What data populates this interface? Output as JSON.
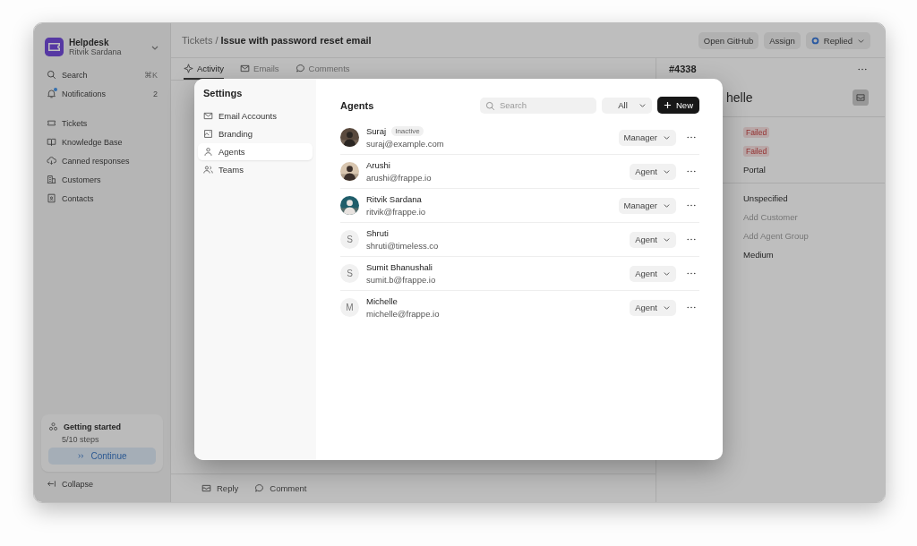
{
  "sidebar": {
    "app_name": "Helpdesk",
    "user_name": "Ritvik Sardana",
    "search": {
      "label": "Search",
      "shortcut": "⌘K"
    },
    "notifications": {
      "label": "Notifications",
      "count": "2",
      "unread": true
    },
    "items": [
      {
        "label": "Tickets"
      },
      {
        "label": "Knowledge Base"
      },
      {
        "label": "Canned responses"
      },
      {
        "label": "Customers"
      },
      {
        "label": "Contacts"
      }
    ],
    "getting_started": {
      "title": "Getting started",
      "steps": "5/10 steps",
      "button": "Continue"
    },
    "collapse": "Collapse"
  },
  "header": {
    "breadcrumb_parent": "Tickets",
    "separator": "/",
    "title": "Issue with password reset email",
    "buttons": [
      "Open GitHub",
      "Assign"
    ],
    "status": "Replied"
  },
  "tabs": [
    {
      "label": "Activity",
      "selected": true
    },
    {
      "label": "Emails",
      "selected": false
    },
    {
      "label": "Comments",
      "selected": false
    }
  ],
  "ticket_panel": {
    "id": "#4338",
    "contact_name": "helle",
    "fields": [
      {
        "value": "Failed",
        "kind": "error"
      },
      {
        "value": "Failed",
        "kind": "error"
      },
      {
        "value": "Portal",
        "kind": "value"
      },
      {
        "value": "Unspecified",
        "kind": "value"
      },
      {
        "placeholder": "Add Customer",
        "kind": "placeholder"
      },
      {
        "placeholder": "Add Agent Group",
        "kind": "placeholder"
      },
      {
        "value": "Medium",
        "kind": "value"
      }
    ]
  },
  "composer": {
    "actions": [
      "Reply",
      "Comment"
    ]
  },
  "settings": {
    "title": "Settings",
    "nav": [
      {
        "label": "Email Accounts",
        "selected": false
      },
      {
        "label": "Branding",
        "selected": false
      },
      {
        "label": "Agents",
        "selected": true
      },
      {
        "label": "Teams",
        "selected": false
      }
    ],
    "page_title": "Agents",
    "search": {
      "placeholder": "Search"
    },
    "filter": "All",
    "new_button": "New",
    "agents": [
      {
        "name": "Suraj",
        "email": "suraj@example.com",
        "inactive": true,
        "inactive_label": "Inactive",
        "role": "Manager",
        "kind": "picture"
      },
      {
        "name": "Arushi",
        "email": "arushi@frappe.io",
        "inactive": false,
        "role": "Agent",
        "kind": "picture"
      },
      {
        "name": "Ritvik Sardana",
        "email": "ritvik@frappe.io",
        "inactive": false,
        "role": "Manager",
        "kind": "picture"
      },
      {
        "name": "Shruti",
        "email": "shruti@timeless.co",
        "inactive": false,
        "role": "Agent",
        "kind": "initial",
        "initial": "S"
      },
      {
        "name": "Sumit Bhanushali",
        "email": "sumit.b@frappe.io",
        "inactive": false,
        "role": "Agent",
        "kind": "initial",
        "initial": "S"
      },
      {
        "name": "Michelle",
        "email": "michelle@frappe.io",
        "inactive": false,
        "role": "Agent",
        "kind": "initial",
        "initial": "M"
      }
    ]
  }
}
